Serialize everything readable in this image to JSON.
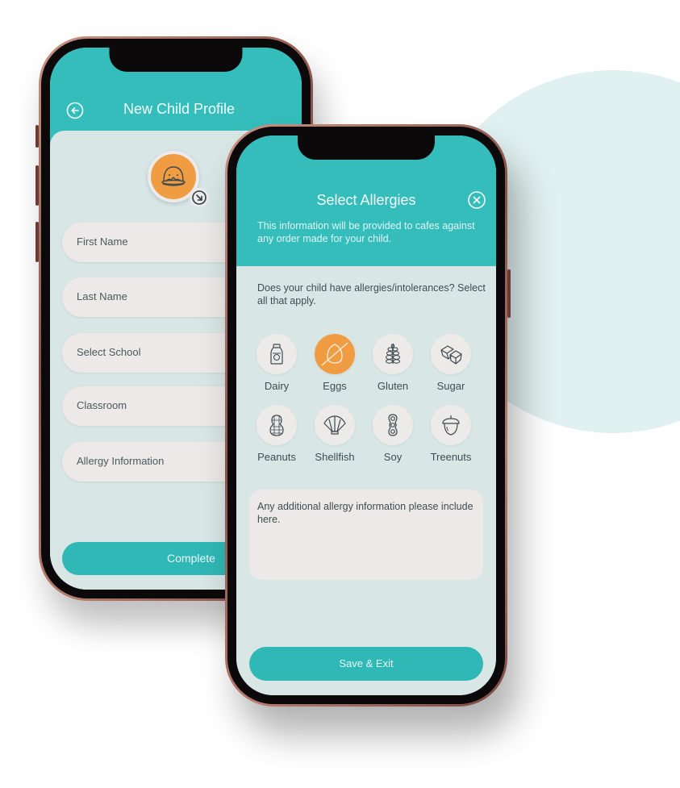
{
  "colors": {
    "primary_teal": "#35bdbb",
    "button_teal": "#30b8b6",
    "accent_orange": "#f09c43",
    "screen_background": "#d9e6e6",
    "field_background": "#ece9e8",
    "background_circle": "#e1f0f0"
  },
  "profile_screen": {
    "title": "New Child Profile",
    "back_icon": "back-arrow-circle-icon",
    "avatar_icon": "duck-avatar-icon",
    "avatar_edit_icon": "arrow-down-right-circle-icon",
    "fields": [
      {
        "placeholder": "First Name"
      },
      {
        "placeholder": "Last Name"
      },
      {
        "placeholder": "Select School"
      },
      {
        "placeholder": "Classroom"
      },
      {
        "placeholder": "Allergy Information"
      }
    ],
    "complete_label": "Complete"
  },
  "allergy_screen": {
    "title": "Select Allergies",
    "close_icon": "close-circle-icon",
    "subtitle": "This information will be provided to cafes against any order made for your child.",
    "question": "Does your child have allergies/intolerances? Select all that apply.",
    "allergies": [
      {
        "label": "Dairy",
        "icon": "milk-bottle-icon",
        "selected": false
      },
      {
        "label": "Eggs",
        "icon": "egg-icon",
        "selected": true
      },
      {
        "label": "Gluten",
        "icon": "wheat-icon",
        "selected": false
      },
      {
        "label": "Sugar",
        "icon": "sugar-cubes-icon",
        "selected": false
      },
      {
        "label": "Peanuts",
        "icon": "peanut-icon",
        "selected": false
      },
      {
        "label": "Shellfish",
        "icon": "shell-icon",
        "selected": false
      },
      {
        "label": "Soy",
        "icon": "soybean-icon",
        "selected": false
      },
      {
        "label": "Treenuts",
        "icon": "acorn-icon",
        "selected": false
      }
    ],
    "additional_info_placeholder": "Any additional allergy information please include here.",
    "save_label": "Save & Exit"
  }
}
